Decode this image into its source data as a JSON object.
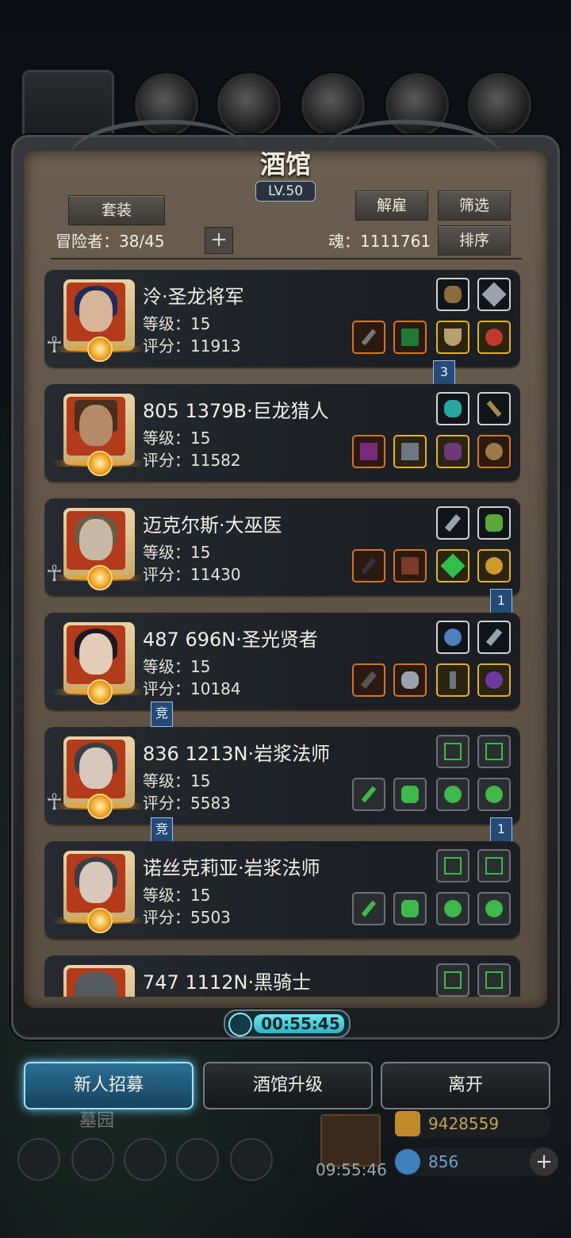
{
  "tavern": {
    "title": "酒馆",
    "level": "LV.50",
    "outfit_button": "套装",
    "dismiss_button": "解雇",
    "filter_button": "筛选",
    "sort_button": "排序",
    "adventurers_label": "冒险者：38/45",
    "soul_label": "魂：1111761",
    "add_button": "+"
  },
  "heroes": [
    {
      "name": "泠·圣龙将军",
      "level": "等级：15",
      "score": "评分：11913",
      "tag": "3"
    },
    {
      "name": "805 1379B·巨龙猎人",
      "level": "等级：15",
      "score": "评分：11582",
      "tag": ""
    },
    {
      "name": "迈克尔斯·大巫医",
      "level": "等级：15",
      "score": "评分：11430",
      "tag": "1"
    },
    {
      "name": "487 696N·圣光贤者",
      "level": "等级：15",
      "score": "评分：10184",
      "tag": "竞"
    },
    {
      "name": "836 1213N·岩浆法师",
      "level": "等级：15",
      "score": "评分：5583",
      "tag": "竞"
    },
    {
      "name": "诺丝克莉亚·岩浆法师",
      "level": "等级：15",
      "score": "评分：5503",
      "tag": "1"
    },
    {
      "name": "747 1112N·黑骑士",
      "level": "",
      "score": "",
      "tag": ""
    }
  ],
  "timer": "00:55:45",
  "bottom": {
    "recruit": "新人招募",
    "upgrade": "酒馆升级",
    "leave": "离开"
  },
  "background": {
    "location": "墓园",
    "gift_timer": "09:55:46",
    "gold": "9428559",
    "gems": "856"
  }
}
